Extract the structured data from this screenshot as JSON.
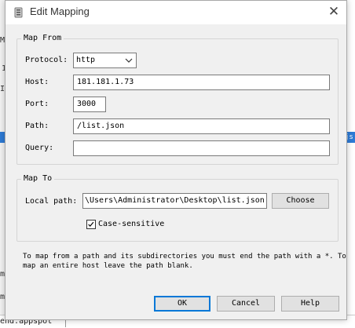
{
  "dialog": {
    "title": "Edit Mapping",
    "close_glyph": "✕"
  },
  "map_from": {
    "legend": "Map From",
    "protocol_label": "Protocol:",
    "protocol_value": "http",
    "host_label": "Host:",
    "host_value": "181.181.1.73",
    "port_label": "Port:",
    "port_value": "3000",
    "path_label": "Path:",
    "path_value": "/list.json",
    "query_label": "Query:",
    "query_value": ""
  },
  "map_to": {
    "legend": "Map To",
    "local_path_label": "Local path:",
    "local_path_value": "\\Users\\Administrator\\Desktop\\list.json",
    "choose_label": "Choose",
    "case_sensitive_label": "Case-sensitive",
    "case_sensitive_checked": true
  },
  "hint": {
    "line1": "To map from a path and its subdirectories you must end the path with a *. To",
    "line2": "map an entire host leave the path blank."
  },
  "buttons": {
    "ok": "OK",
    "cancel": "Cancel",
    "help": "Help"
  },
  "background": {
    "left_letters": [
      "M",
      "1",
      "In",
      "m",
      "m"
    ],
    "right_selected": "js",
    "bottom_text": "end.appspot"
  },
  "colors": {
    "accent": "#0078d7",
    "selection": "#2e7bd6"
  },
  "icons": {
    "title": "app-icon",
    "close": "close-icon",
    "dropdown": "chevron-down-icon",
    "check": "checkmark-icon"
  }
}
